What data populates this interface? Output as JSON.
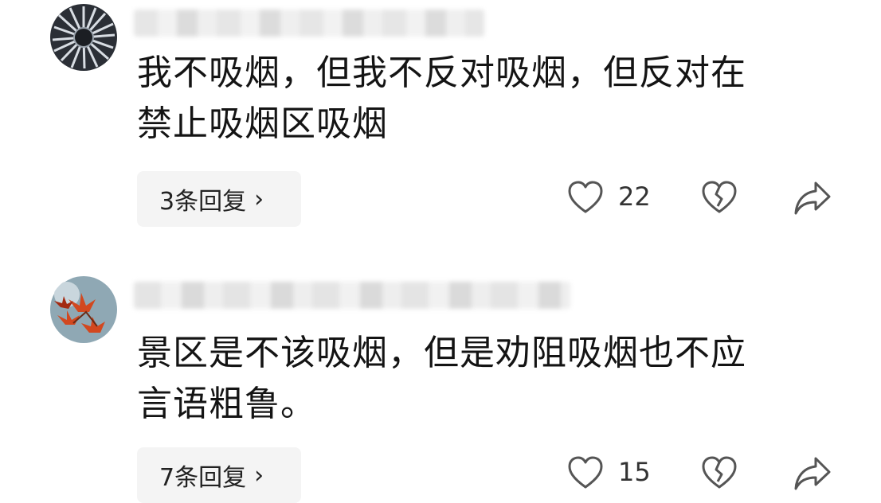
{
  "comments": [
    {
      "text_line1": "我不吸烟，但我不反对吸烟，但反对在",
      "text_line2": "禁止吸烟区吸烟",
      "replies_label": "3条回复",
      "likes": "22"
    },
    {
      "text_line1": "景区是不该吸烟，但是劝阻吸烟也不应",
      "text_line2": "言语粗鲁。",
      "replies_label": "7条回复",
      "likes": "15"
    }
  ],
  "icons": {
    "reply_chevron": "chevron-right-icon",
    "like": "heart-icon",
    "dislike": "broken-heart-icon",
    "share": "share-arrow-icon"
  },
  "colors": {
    "text": "#141414",
    "secondary": "#333333",
    "reply_bg": "#f4f4f4",
    "icon_stroke": "#555555"
  }
}
